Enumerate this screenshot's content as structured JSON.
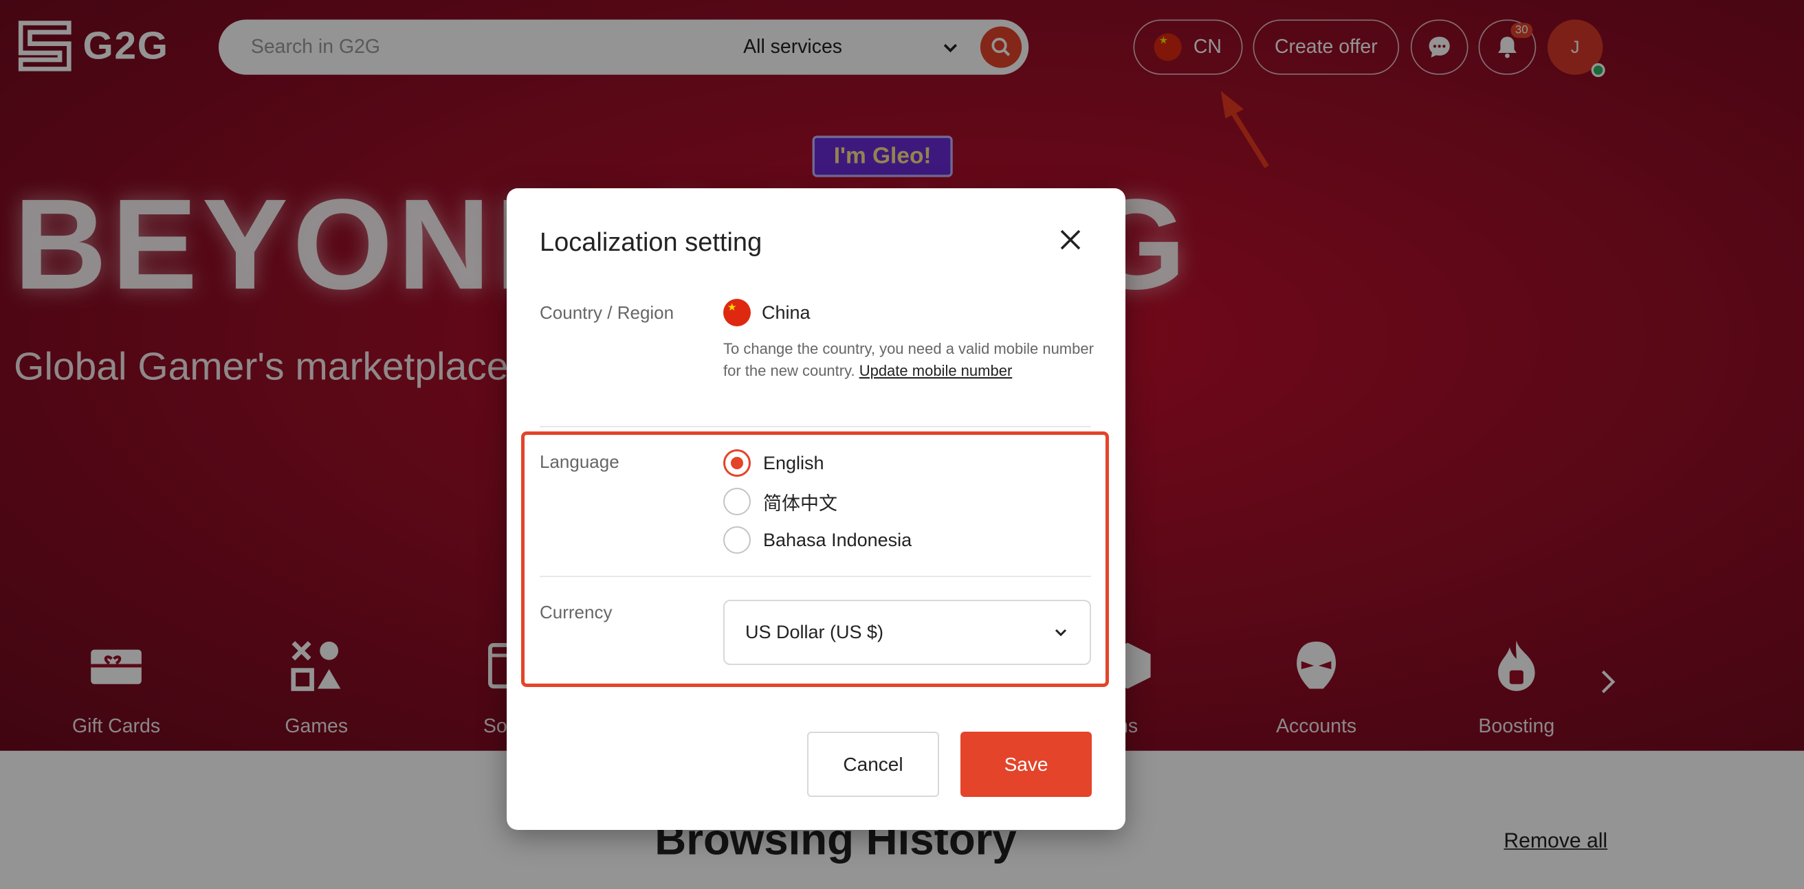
{
  "header": {
    "logo_text": "G2G",
    "search_placeholder": "Search in G2G",
    "service_selected": "All services",
    "country_code": "CN",
    "create_offer_label": "Create offer",
    "notification_count": "30",
    "avatar_initial": "J"
  },
  "hero": {
    "headline": "BEYOND GAMING",
    "subline": "Global Gamer's marketplace",
    "mascot_label": "I'm Gleo!"
  },
  "categories": [
    {
      "label": "Gift Cards",
      "icon": "gift-card-icon"
    },
    {
      "label": "Games",
      "icon": "games-icon"
    },
    {
      "label": "Softwa",
      "icon": "software-icon"
    },
    {
      "label": "ns",
      "icon": "items-icon"
    },
    {
      "label": "Accounts",
      "icon": "accounts-icon"
    },
    {
      "label": "Boosting",
      "icon": "boosting-icon"
    }
  ],
  "history": {
    "title": "Browsing History",
    "remove_all": "Remove all"
  },
  "modal": {
    "title": "Localization setting",
    "country_label": "Country / Region",
    "country_name": "China",
    "country_note": "To change the country, you need a valid mobile number for the new country.",
    "country_link": "Update mobile number",
    "language_label": "Language",
    "languages": [
      {
        "label": "English",
        "checked": true
      },
      {
        "label": "简体中文",
        "checked": false
      },
      {
        "label": "Bahasa Indonesia",
        "checked": false
      }
    ],
    "currency_label": "Currency",
    "currency_value": "US Dollar (US $)",
    "cancel_label": "Cancel",
    "save_label": "Save"
  },
  "colors": {
    "accent": "#e3442a",
    "hero_bg": "#9e0e28",
    "online": "#2fb463"
  }
}
